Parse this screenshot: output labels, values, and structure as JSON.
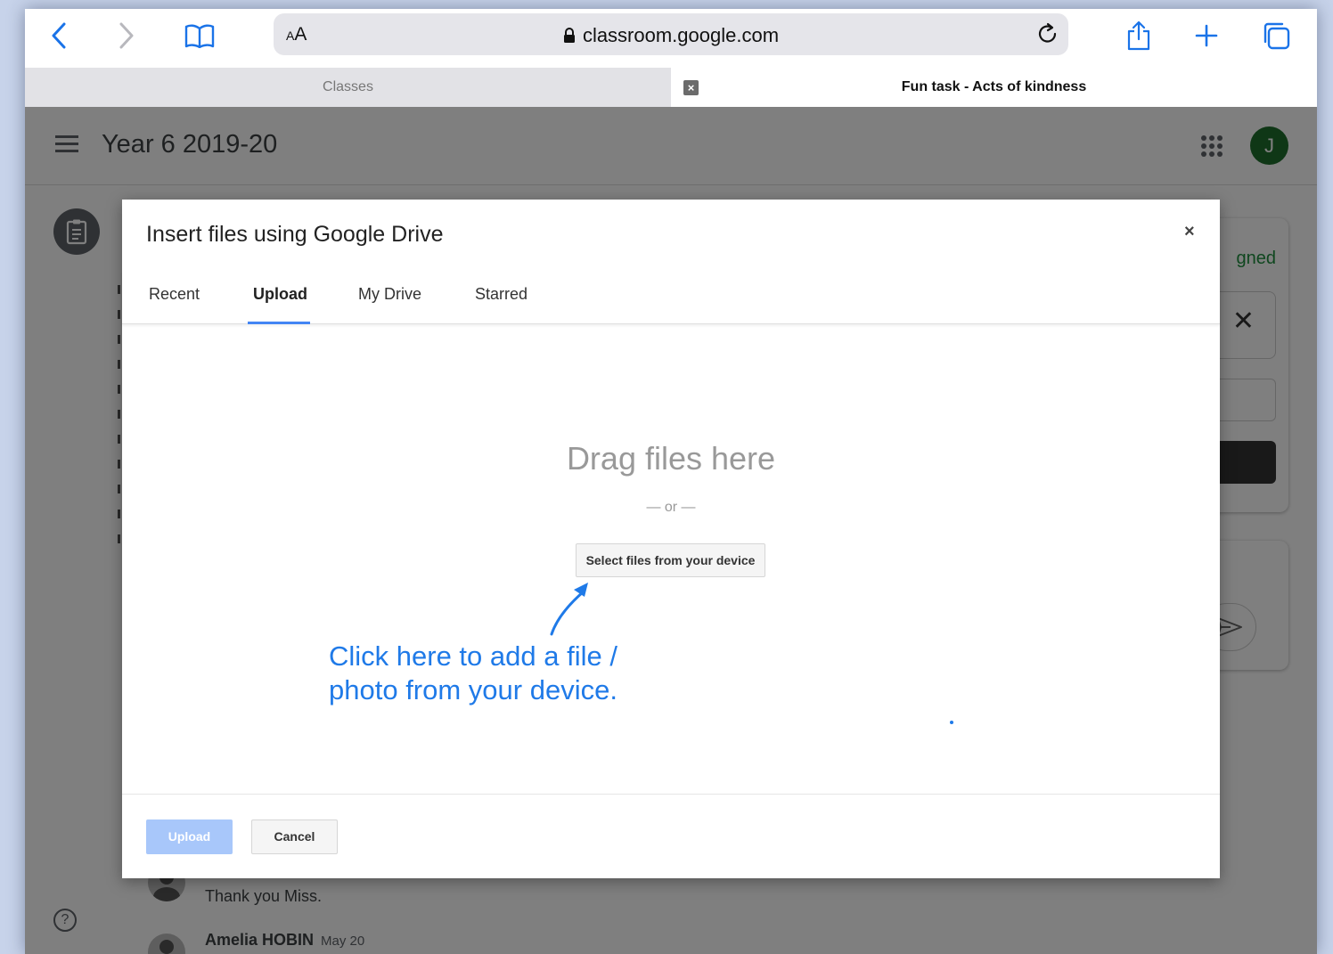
{
  "browser": {
    "text_size_label_small": "A",
    "text_size_label_large": "A",
    "url": "classroom.google.com",
    "tabs": [
      {
        "label": "Classes",
        "active": false
      },
      {
        "label": "Fun task - Acts of kindness",
        "active": true
      }
    ],
    "tab_close_glyph": "×"
  },
  "classroom": {
    "class_title": "Year 6 2019-20",
    "avatar_letter": "J",
    "status_partial": "gned",
    "close_glyph": "✕",
    "comments": [
      {
        "text": "Thank you Miss."
      },
      {
        "name": "Amelia HOBIN",
        "date": "May 20"
      }
    ],
    "help_glyph": "?"
  },
  "dialog": {
    "title": "Insert files using Google Drive",
    "close_glyph": "×",
    "tabs": [
      {
        "label": "Recent"
      },
      {
        "label": "Upload",
        "active": true
      },
      {
        "label": "My Drive"
      },
      {
        "label": "Starred"
      }
    ],
    "drag_text": "Drag files here",
    "or_text": "— or —",
    "select_button": "Select files from your device",
    "upload_button": "Upload",
    "cancel_button": "Cancel"
  },
  "annotation": {
    "line1": "Click here to add a file /",
    "line2": "photo from your device.",
    "color": "#1f7ae8"
  },
  "colors": {
    "accent": "#4285f4",
    "upload_disabled": "#a8c7fa",
    "avatar": "#1f6e2c",
    "safari_blue": "#1a73e8"
  }
}
